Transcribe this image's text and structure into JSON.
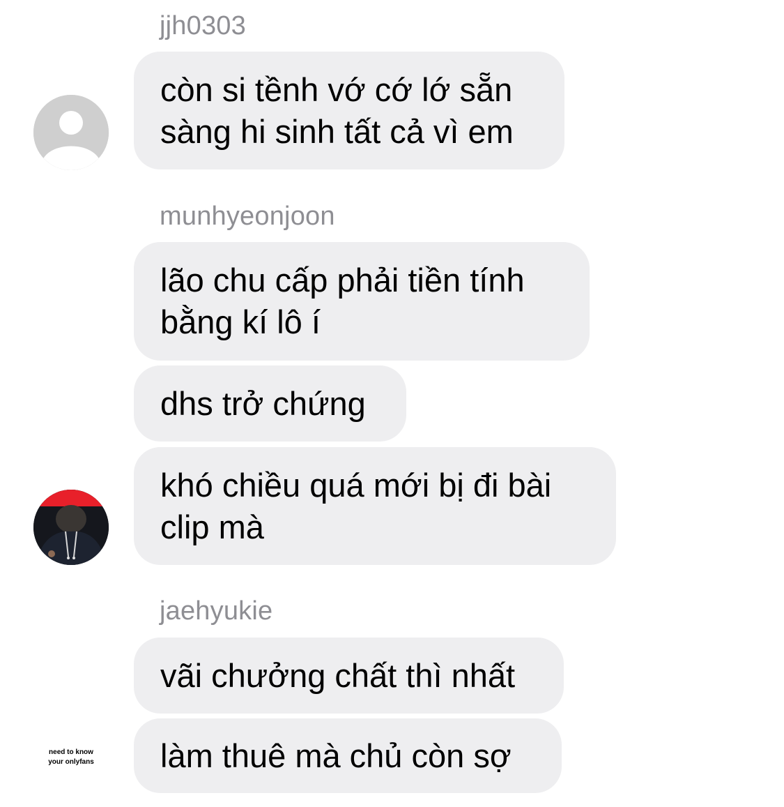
{
  "messages_group_1": {
    "sender": "jjh0303",
    "bubbles": [
      {
        "text": "còn si tềnh vớ cớ lớ sẵn\nsàng hi sinh tất cả vì em"
      }
    ]
  },
  "messages_group_2": {
    "sender": "munhyeonjoon",
    "bubbles": [
      {
        "text": "lão chu cấp phải tiền tính\nbằng kí lô í"
      },
      {
        "text": "dhs trở chứng"
      },
      {
        "text": "khó chiều quá mới bị đi bài\nclip mà"
      }
    ]
  },
  "messages_group_3": {
    "sender": "jaehyukie",
    "avatar_text": "need to know\nyour onlyfans",
    "bubbles": [
      {
        "text": "vãi chưởng chất thì nhất"
      },
      {
        "text": "làm thuê mà chủ còn sợ"
      }
    ]
  },
  "colors": {
    "bubble_bg": "#eeeef0",
    "sender_text": "#8e8e93",
    "message_text": "#000000",
    "default_avatar": "#cfcfcf",
    "avatar_accent_red": "#e8202a"
  },
  "icons": {
    "default_avatar": "person-silhouette-icon"
  }
}
